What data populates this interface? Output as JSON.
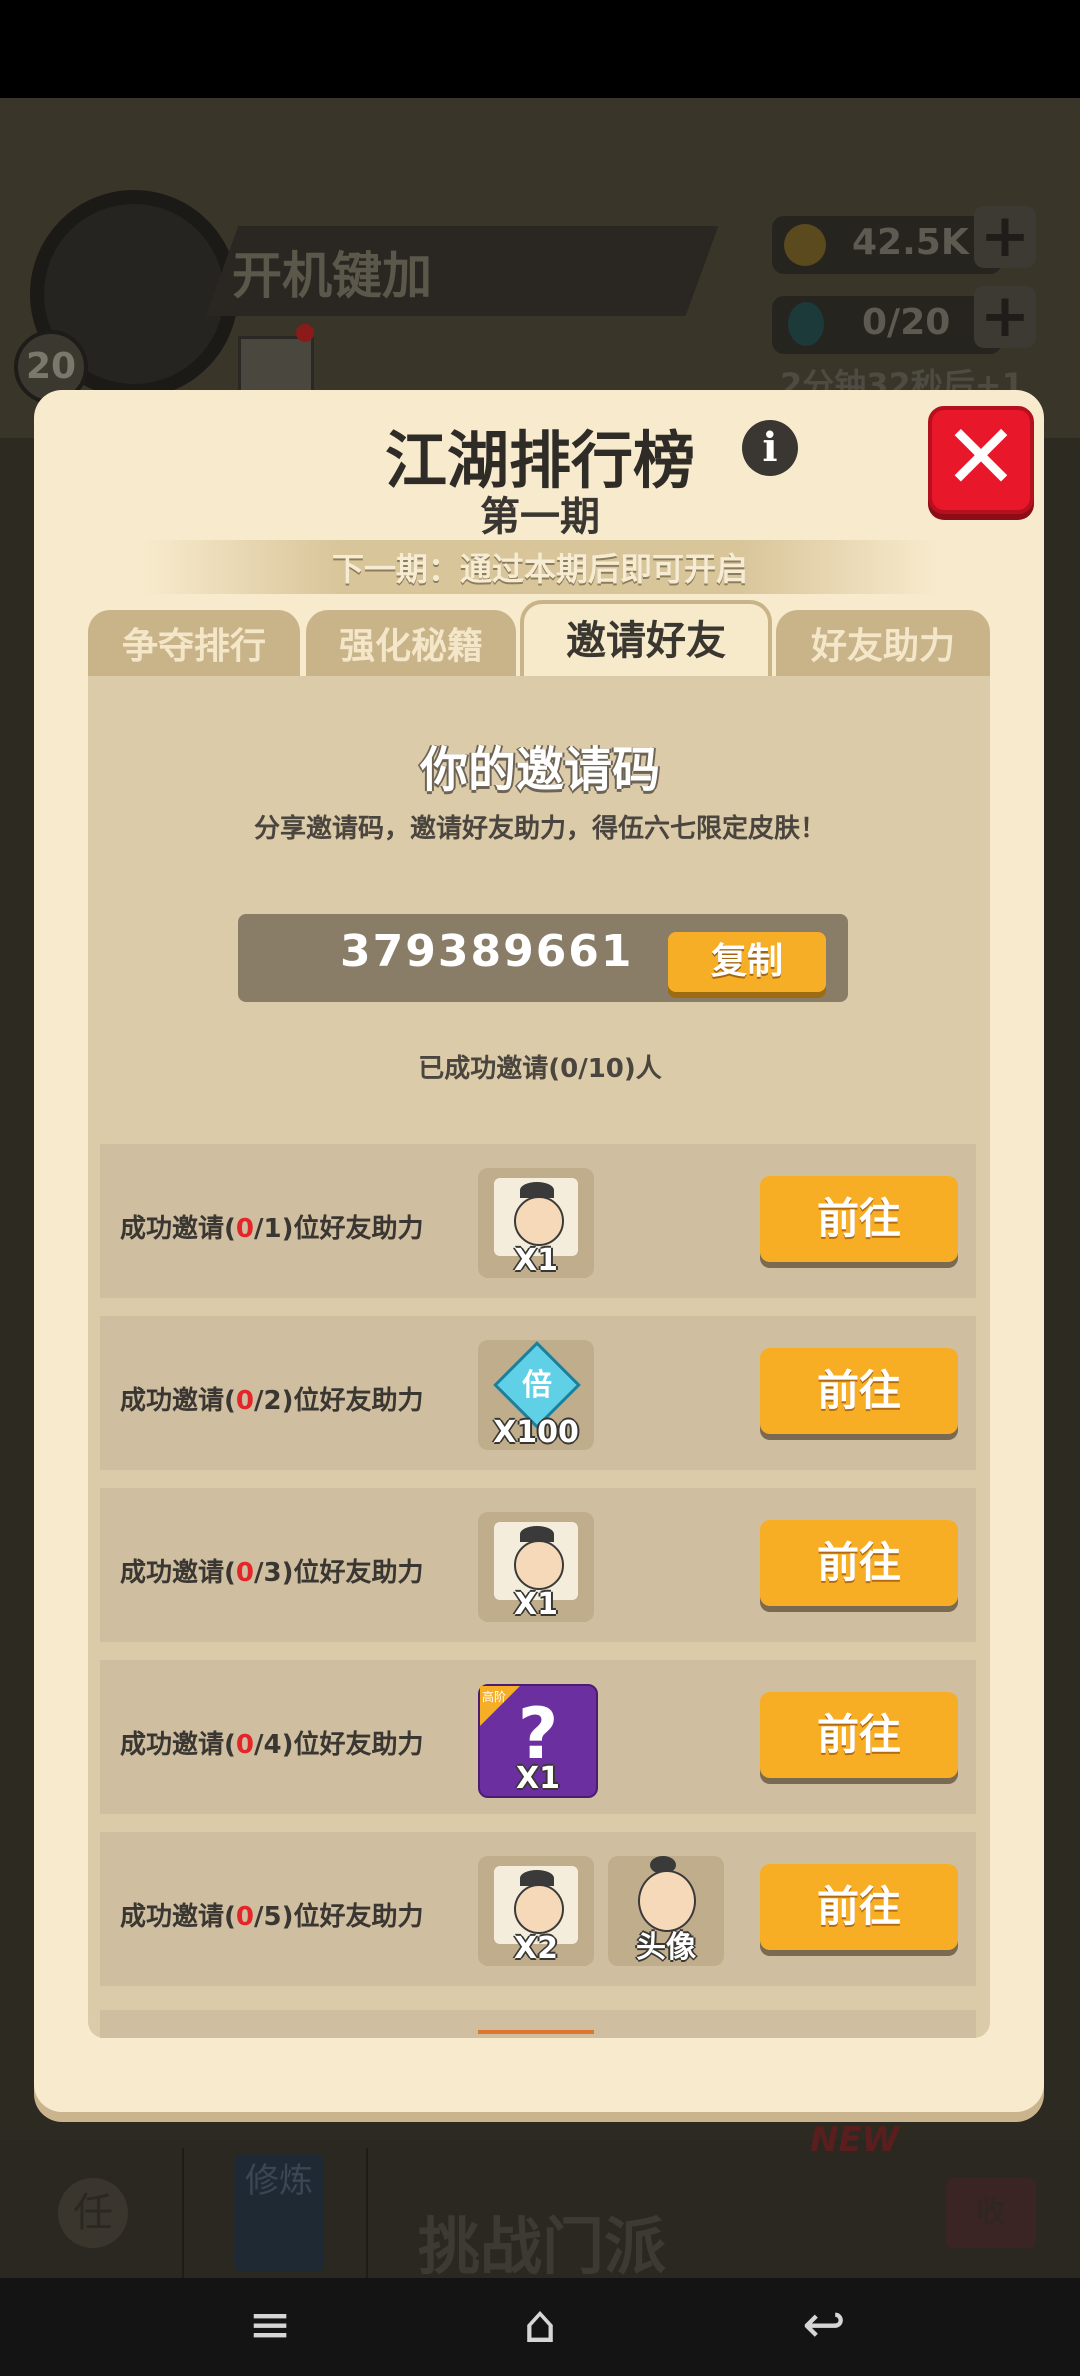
{
  "background": {
    "player_name": "开机键加",
    "level": "20",
    "coins": "42.5K",
    "gems": "0/20",
    "timer": "2分钟32秒后+1",
    "bottom_title": "挑战门派",
    "bottom_badge": "NEW",
    "bottom_icons": [
      "任",
      "修炼",
      "收"
    ]
  },
  "modal": {
    "title": "江湖排行榜",
    "subtitle": "第一期",
    "next_period": "下一期：通过本期后即可开启",
    "tabs": [
      {
        "label": "争夺排行",
        "active": false
      },
      {
        "label": "强化秘籍",
        "active": false
      },
      {
        "label": "邀请好友",
        "active": true
      },
      {
        "label": "好友助力",
        "active": false
      }
    ],
    "code_section": {
      "title": "你的邀请码",
      "description": "分享邀请码，邀请好友助力，得伍六七限定皮肤！",
      "code": "379389661",
      "copy_label": "复制",
      "invited_status": "已成功邀请(0/10)人"
    },
    "rows": [
      {
        "prefix": "成功邀请(",
        "done": "0",
        "suffix": "/1)位好友助力",
        "rewards": [
          {
            "kind": "character-fragment",
            "qty": "X1"
          }
        ],
        "button": "前往"
      },
      {
        "prefix": "成功邀请(",
        "done": "0",
        "suffix": "/2)位好友助力",
        "rewards": [
          {
            "kind": "diamond-multiplier",
            "glyph": "倍",
            "qty": "X100"
          }
        ],
        "button": "前往"
      },
      {
        "prefix": "成功邀请(",
        "done": "0",
        "suffix": "/3)位好友助力",
        "rewards": [
          {
            "kind": "character-fragment",
            "qty": "X1"
          }
        ],
        "button": "前往"
      },
      {
        "prefix": "成功邀请(",
        "done": "0",
        "suffix": "/4)位好友助力",
        "rewards": [
          {
            "kind": "mystery-box",
            "tag": "高阶",
            "qty": "X1"
          }
        ],
        "button": "前往"
      },
      {
        "prefix": "成功邀请(",
        "done": "0",
        "suffix": "/5)位好友助力",
        "rewards": [
          {
            "kind": "character-fragment",
            "qty": "X2"
          },
          {
            "kind": "avatar",
            "qty": "头像"
          }
        ],
        "button": "前往"
      }
    ]
  },
  "colors": {
    "accent": "#f7ad24",
    "close": "#e8172a",
    "highlight_red": "#e4262a",
    "panel": "#dccba8"
  },
  "system_nav": {
    "menu": "≡",
    "home": "⌂",
    "back": "↩"
  }
}
